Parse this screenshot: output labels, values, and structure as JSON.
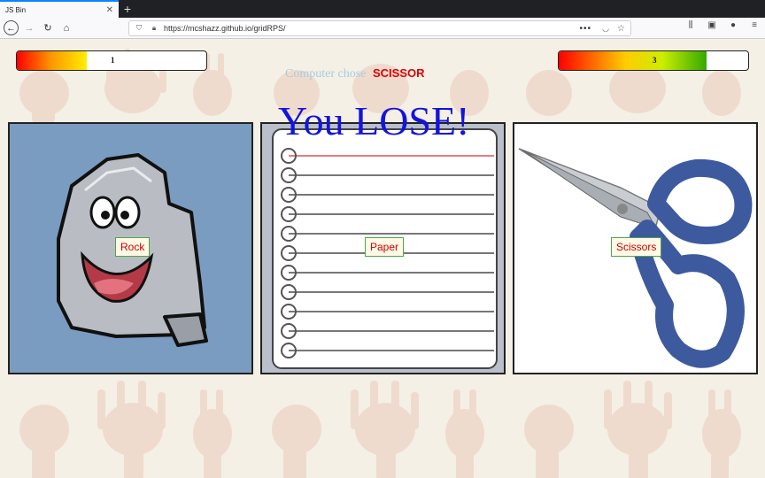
{
  "browser": {
    "tab_title": "JS Bin",
    "tab_close": "✕",
    "new_tab": "+",
    "url": "https://mcshazz.github.io/gridRPS/",
    "more_dots": "•••"
  },
  "scores": {
    "player": "1",
    "player_fill": 0.37,
    "computer": "3",
    "computer_fill": 0.78
  },
  "computer_choice": {
    "label": "Computer chose",
    "value": "SCISSOR"
  },
  "result": "You LOSE!",
  "cards": [
    {
      "id": "rock",
      "label": "Rock"
    },
    {
      "id": "paper",
      "label": "Paper"
    },
    {
      "id": "scissors",
      "label": "Scissors"
    }
  ],
  "colors": {
    "result_text": "#1313e0",
    "choice_value": "#dd0000",
    "rock_bg": "#7b9cc1",
    "scissor_handle": "#3d5a9e"
  }
}
